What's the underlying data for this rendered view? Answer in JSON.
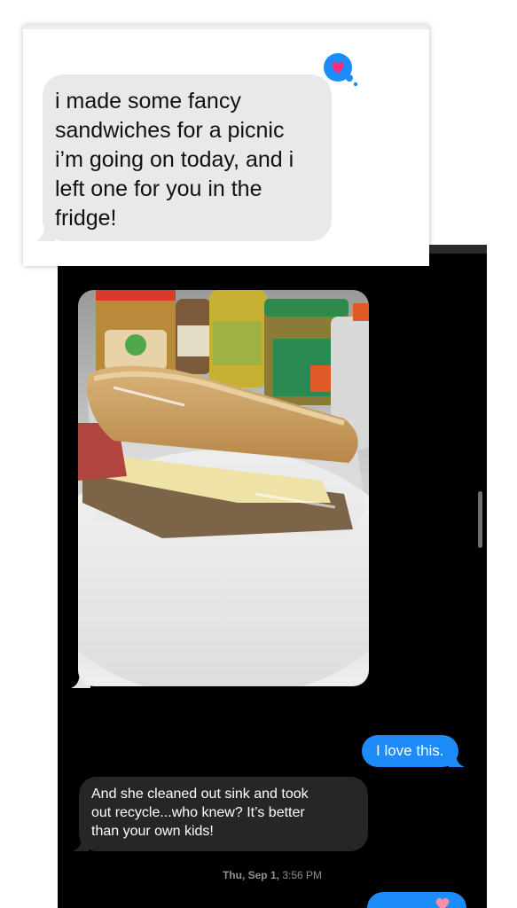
{
  "light_message": {
    "lines": [
      "i made some fancy",
      "sandwiches for a picnic",
      "i’m going on today, and i",
      "left one for you in the",
      "fridge!"
    ],
    "reaction_icon": "heart-reaction-icon",
    "reaction_color": "#1d8cf8",
    "heart_color": "#ff2d7a"
  },
  "dark_thread": {
    "photo_description_icon": "sandwich-photo",
    "sent_message": "I love this.",
    "received_message_lines": [
      "And she cleaned out sink and took",
      "out recycle...who knew? It’s better",
      "than your own kids!"
    ],
    "timestamp_day": "Thu, Sep 1,",
    "timestamp_time": "3:56 PM",
    "sent_color": "#1d8cf8",
    "received_color": "#262628"
  }
}
